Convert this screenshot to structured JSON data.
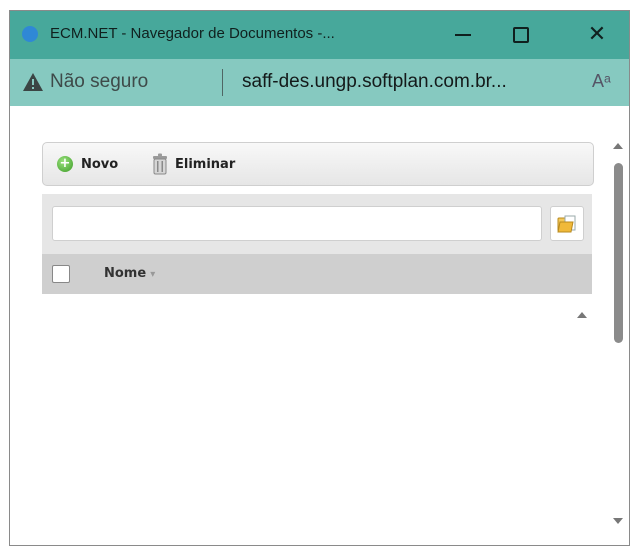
{
  "window": {
    "title": "ECM.NET - Navegador de Documentos -...",
    "minimize_icon": "minimize-icon",
    "maximize_icon": "maximize-icon",
    "close_symbol": "✕"
  },
  "address_bar": {
    "security_label": "Não seguro",
    "url": "saff-des.ungp.softplan.com.br...",
    "read_aloud_symbol": "Aᵃ"
  },
  "toolbar": {
    "new_label": "Novo",
    "delete_label": "Eliminar"
  },
  "filter": {
    "value": ""
  },
  "grid": {
    "columns": [
      {
        "label": "Nome",
        "sort_symbol": "▾"
      }
    ],
    "rows": []
  },
  "colors": {
    "title_bar": "#47a89b",
    "address_bar": "#86c9c0",
    "toolbar_bg": "#f0f0f0",
    "grid_header": "#cfcfcf"
  }
}
